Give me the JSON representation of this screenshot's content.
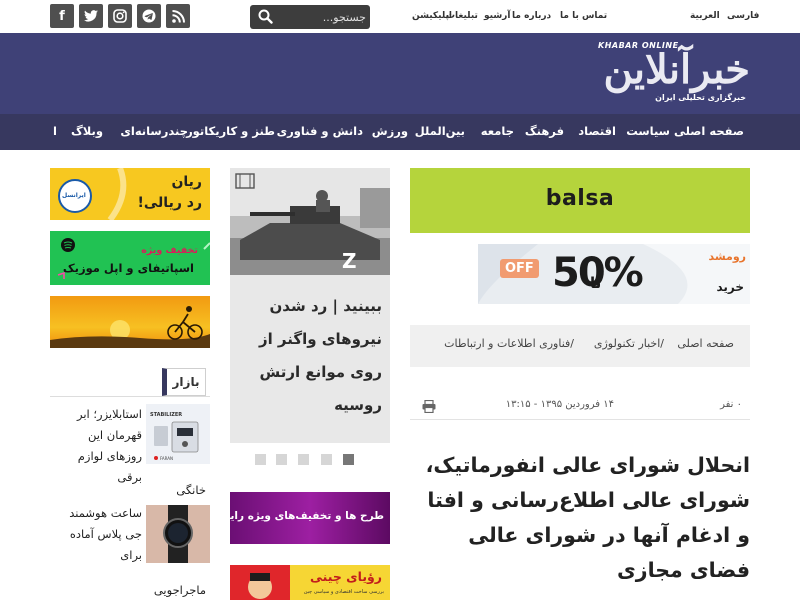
{
  "topbar": {
    "search_placeholder": "جستجو...",
    "social_icons": [
      "facebook-icon",
      "twitter-icon",
      "instagram-icon",
      "telegram-icon",
      "rss-icon"
    ],
    "links": [
      "تماس با ما",
      "درباره ما",
      "آرشیو",
      "تبلیغات",
      "اپلیکیشن"
    ],
    "languages": [
      "العربية",
      "فارسی"
    ]
  },
  "header": {
    "logo_text": "خبرآنلاین",
    "logo_en": "KHABAR ONLINE",
    "tagline": "خبرگزاری تحلیلی ایران",
    "bg_color": "#3f4177"
  },
  "nav": {
    "items": [
      "صفحه اصلی",
      "سیاست",
      "اقتصاد",
      "فرهنگ",
      "جامعه",
      "بین‌الملل",
      "ورزش",
      "دانش و فناوری",
      "طنز و کاریکاتور",
      "چندرسانه‌ای",
      "وبلاگ",
      "ا"
    ],
    "bg_color": "#37385f"
  },
  "left_ads": {
    "ad1_lines": [
      "ریان",
      "رد ریالی!"
    ],
    "ad1_logo": "ایرانسل",
    "ad2_lines": [
      "تخفیف ویژه",
      "اسپاتیفای و اپل موزیک"
    ],
    "bazaar_label": "بازار",
    "bazaar_items": [
      {
        "title": "استابلایزر؛ ابر قهرمان این روزهای لوازم برقی",
        "tag": "خانگی",
        "img_label": "STABILIZER"
      },
      {
        "title": "ساعت هوشمند جی پلاس آماده برای",
        "tag": "ماجراجویی"
      }
    ]
  },
  "slider": {
    "title": "ببینید | رد شدن نیروهای واگنر از روی موانع ارتش روسیه",
    "dots": 5,
    "active_dot": 4
  },
  "middle_ads": {
    "ad1": "طرح ها و تخفیف‌های ویژه رایتل",
    "ad2_title": "رؤیای چینی",
    "ad2_sub": "بررسی‌ ساخت اقتصادی و سیاسی چین"
  },
  "right": {
    "balsa_label": "balsa",
    "off_banner": {
      "percent": "50%",
      "ta": "تا",
      "off": "OFF",
      "brand": "رومشد",
      "cta": "خرید"
    },
    "breadcrumb": [
      "صفحه اصلی",
      "/اخبار تکنولوژی",
      "/فناوری اطلاعات و ارتباطات"
    ],
    "date": "۱۴ فروردین ۱۳۹۵ - ۱۳:۱۵",
    "views": "۰ نفر",
    "article_title": "انحلال شورای عالی انفورماتیک، شورای عالی اطلاع‌رسانی و افتا و ادغام آنها در شورای عالی فضای مجازی"
  }
}
